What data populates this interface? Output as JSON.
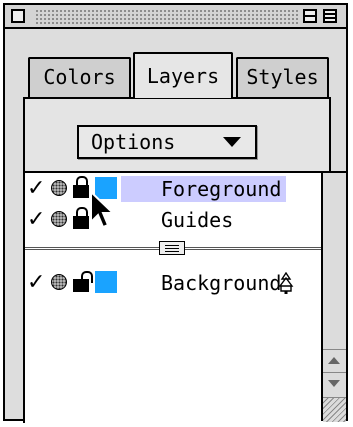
{
  "window": {
    "title": ""
  },
  "tabs": [
    {
      "label": "Colors",
      "active": false
    },
    {
      "label": "Layers",
      "active": true
    },
    {
      "label": "Styles",
      "active": false
    }
  ],
  "options_button": {
    "label": "Options"
  },
  "layers": [
    {
      "name": "Foreground",
      "visible": true,
      "locked": true,
      "selected": true,
      "swatch": "#1aa3ff"
    },
    {
      "name": "Guides",
      "visible": true,
      "locked": true,
      "selected": false,
      "swatch": null
    },
    {
      "name": "Background",
      "visible": true,
      "locked": false,
      "selected": false,
      "swatch": "#1aa3ff"
    }
  ],
  "icons": {
    "check": "✓",
    "selection_highlight": "#ccccff"
  }
}
